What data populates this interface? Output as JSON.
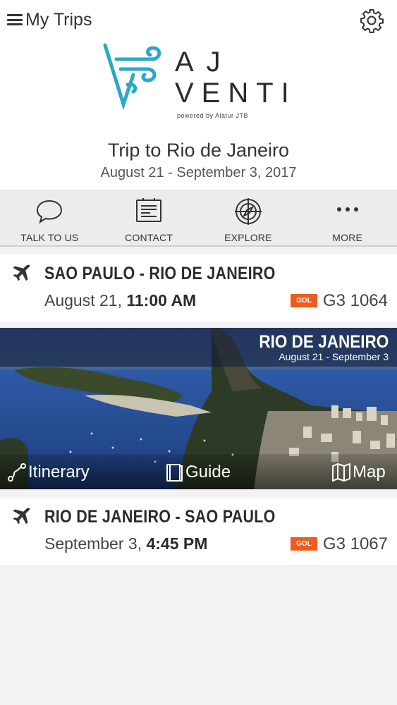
{
  "header": {
    "menu_label": "My Trips",
    "menu_icon": "hamburger-icon",
    "settings_icon": "gear-icon"
  },
  "brand": {
    "line1": "AJ",
    "line2": "VENTI",
    "powered": "powered by Alatur JTB",
    "accent": "#2aa7c9"
  },
  "trip": {
    "title": "Trip to Rio de Janeiro",
    "dates": "August 21 - September 3, 2017"
  },
  "actions": [
    {
      "label": "TALK TO US",
      "icon": "chat-bubble-icon"
    },
    {
      "label": "CONTACT",
      "icon": "contact-card-icon"
    },
    {
      "label": "EXPLORE",
      "icon": "compass-icon"
    },
    {
      "label": "MORE",
      "icon": "more-dots-icon"
    }
  ],
  "flights": [
    {
      "route": "SAO PAULO - RIO DE JANEIRO",
      "date": "August 21,",
      "time": "11:00 AM",
      "airline": "GOL",
      "number": "G3 1064"
    },
    {
      "route": "RIO DE JANEIRO - SAO PAULO",
      "date": "September 3,",
      "time": "4:45 PM",
      "airline": "GOL",
      "number": "G3 1067"
    }
  ],
  "destination": {
    "city": "RIO DE JANEIRO",
    "dates": "August 21 - September 3",
    "links": [
      {
        "label": "Itinerary",
        "icon": "route-icon"
      },
      {
        "label": "Guide",
        "icon": "book-icon"
      },
      {
        "label": "Map",
        "icon": "map-icon"
      }
    ]
  },
  "colors": {
    "airline_badge": "#f05a1d",
    "background": "#f2f2f2"
  }
}
